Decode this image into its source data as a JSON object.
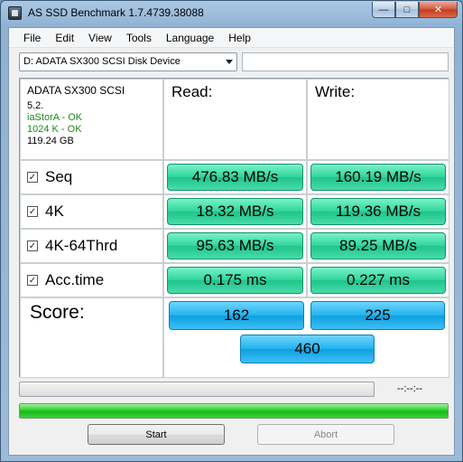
{
  "window": {
    "title": "AS SSD Benchmark 1.7.4739.38088",
    "controls": {
      "minimize": "—",
      "maximize": "□",
      "close": "✕"
    }
  },
  "menu": [
    "File",
    "Edit",
    "View",
    "Tools",
    "Language",
    "Help"
  ],
  "device": {
    "selected": "D: ADATA SX300 SCSI Disk Device",
    "path_value": ""
  },
  "info": {
    "name": "ADATA SX300 SCSI",
    "firmware": "5.2.",
    "driver_status": "iaStorA - OK",
    "alignment_status": "1024 K - OK",
    "capacity": "119.24 GB"
  },
  "headers": {
    "read": "Read:",
    "write": "Write:"
  },
  "tests": [
    {
      "name": "Seq",
      "checked": true,
      "read": "476.83 MB/s",
      "write": "160.19 MB/s"
    },
    {
      "name": "4K",
      "checked": true,
      "read": "18.32 MB/s",
      "write": "119.36 MB/s"
    },
    {
      "name": "4K-64Thrd",
      "checked": true,
      "read": "95.63 MB/s",
      "write": "89.25 MB/s"
    },
    {
      "name": "Acc.time",
      "checked": true,
      "read": "0.175 ms",
      "write": "0.227 ms"
    }
  ],
  "checkbox_mark": "✓",
  "score": {
    "label": "Score:",
    "read": "162",
    "write": "225",
    "total": "460"
  },
  "progress": {
    "time_text": "--:--:--",
    "top_fraction": 0,
    "bottom_fraction": 1.0
  },
  "buttons": {
    "start": "Start",
    "abort": "Abort"
  },
  "colors": {
    "result_green": "#2fd49a",
    "score_blue": "#22b2ec",
    "progress_green": "#23c823",
    "ok_text": "#1a8a1a"
  }
}
